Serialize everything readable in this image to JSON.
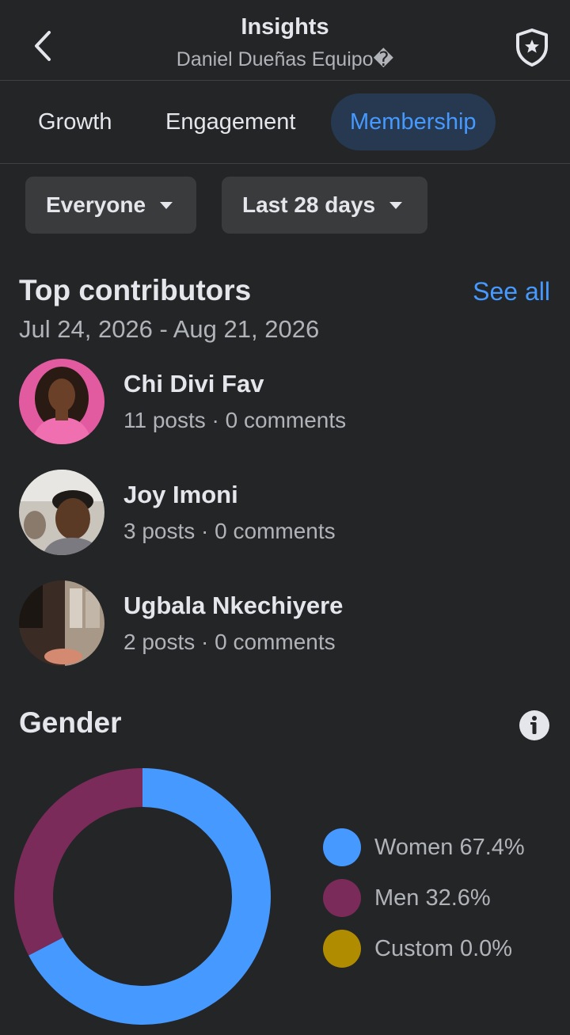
{
  "header": {
    "title": "Insights",
    "subtitle": "Daniel Dueñas Equipo�",
    "back_icon": "chevron-left-icon",
    "admin_icon": "shield-star-icon"
  },
  "tabs": [
    {
      "label": "Growth",
      "active": false
    },
    {
      "label": "Engagement",
      "active": false
    },
    {
      "label": "Membership",
      "active": true
    }
  ],
  "filters": {
    "audience": "Everyone",
    "period": "Last 28 days"
  },
  "top_contributors": {
    "title": "Top contributors",
    "see_all": "See all",
    "date_range": "Jul 24, 2026 - Aug 21, 2026",
    "items": [
      {
        "name": "Chi Divi Fav",
        "stats": "11 posts · 0 comments"
      },
      {
        "name": "Joy Imoni",
        "stats": "3 posts · 0 comments"
      },
      {
        "name": "Ugbala Nkechiyere",
        "stats": "2 posts · 0 comments"
      }
    ]
  },
  "gender": {
    "title": "Gender",
    "info_icon": "info-icon",
    "legend": [
      {
        "label": "Women 67.4%",
        "color": "#4599ff"
      },
      {
        "label": "Men 32.6%",
        "color": "#7a2b5a"
      },
      {
        "label": "Custom 0.0%",
        "color": "#b08c00"
      }
    ]
  },
  "chart_data": {
    "type": "pie",
    "categories": [
      "Women",
      "Men",
      "Custom"
    ],
    "values": [
      67.4,
      32.6,
      0.0
    ],
    "colors": [
      "#4599ff",
      "#7a2b5a",
      "#b08c00"
    ],
    "title": "Gender",
    "legend_position": "right"
  }
}
